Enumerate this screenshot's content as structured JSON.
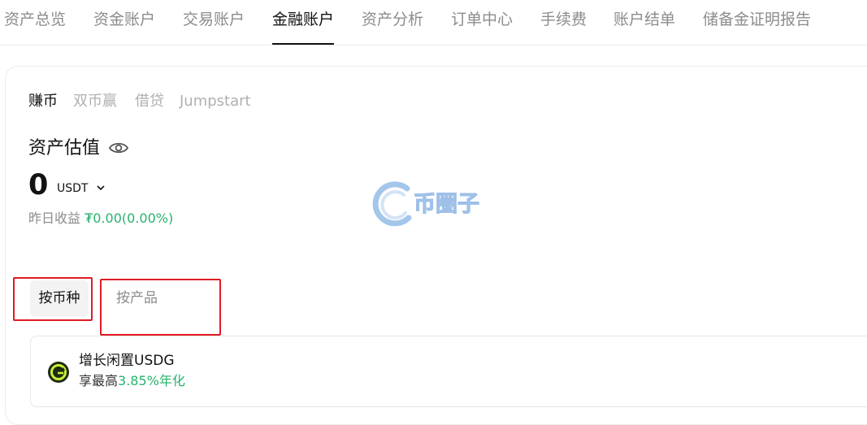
{
  "top_nav": {
    "tabs": [
      {
        "label": "资产总览"
      },
      {
        "label": "资金账户"
      },
      {
        "label": "交易账户"
      },
      {
        "label": "金融账户"
      },
      {
        "label": "资产分析"
      },
      {
        "label": "订单中心"
      },
      {
        "label": "手续费"
      },
      {
        "label": "账户结单"
      },
      {
        "label": "储备金证明报告"
      }
    ],
    "active_tab": "金融账户"
  },
  "sub_tabs": {
    "items": [
      {
        "label": "赚币"
      },
      {
        "label": "双币赢"
      },
      {
        "label": "借贷"
      },
      {
        "label": "Jumpstart"
      }
    ],
    "active": "赚币"
  },
  "valuation": {
    "title": "资产估值",
    "amount": "0",
    "unit": "USDT",
    "yesterday_label": "昨日收益",
    "yesterday_value": "₮0.00(0.00%)"
  },
  "watermark": {
    "text": "币圈子"
  },
  "segment": {
    "by_coin": "按币种",
    "by_product": "按产品",
    "active": "按币种"
  },
  "product_card": {
    "name": "增长闲置USDG",
    "rate_prefix": "享最高",
    "rate_value": "3.85%年化"
  },
  "colors": {
    "accent_green": "#26b36b",
    "highlight_red": "#e01b24",
    "text_primary": "#121212",
    "text_secondary": "#8c8c8c"
  }
}
